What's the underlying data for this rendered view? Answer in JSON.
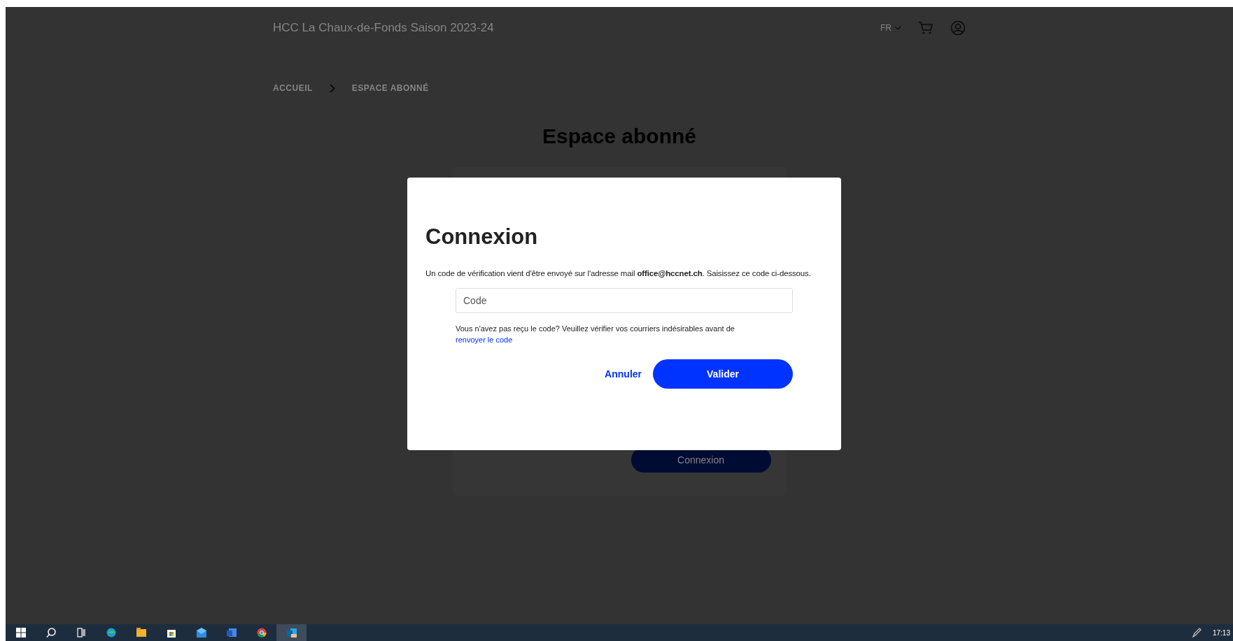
{
  "header": {
    "title": "HCC La Chaux-de-Fonds Saison 2023-24",
    "language": "FR"
  },
  "breadcrumb": [
    {
      "label": "ACCUEIL"
    },
    {
      "label": "ESPACE ABONNÉ"
    }
  ],
  "page_title": "Espace abonné",
  "background_form": {
    "button": "Connexion"
  },
  "dialog": {
    "title": "Connexion",
    "message": "Un code de vérification vient d'être envoyé sur l'adresse mail **office@hccnet.ch**. Saisissez ce code ci-dessous.",
    "code_field": {
      "placeholder": "Code"
    },
    "help_text": "Vous n'avez pas reçu le code? Veuillez vérifier vos courriers indésirables avant de",
    "resend_link": "renvoyer le code",
    "buttons": [
      {
        "label": "Annuler",
        "kind": "secondary"
      },
      {
        "label": "Valider",
        "kind": "primary"
      }
    ]
  },
  "taskbar": {
    "apps": [
      {
        "kind": "start",
        "selected": false
      },
      {
        "kind": "search",
        "selected": false
      },
      {
        "kind": "taskview",
        "selected": false
      },
      {
        "kind": "edge",
        "selected": false
      },
      {
        "kind": "folder",
        "selected": false
      },
      {
        "kind": "store",
        "selected": false
      },
      {
        "kind": "mail",
        "selected": false
      },
      {
        "kind": "word",
        "selected": false
      },
      {
        "kind": "chrome",
        "selected": false
      },
      {
        "kind": "outlook",
        "selected": true
      }
    ],
    "clock": "17:13"
  }
}
